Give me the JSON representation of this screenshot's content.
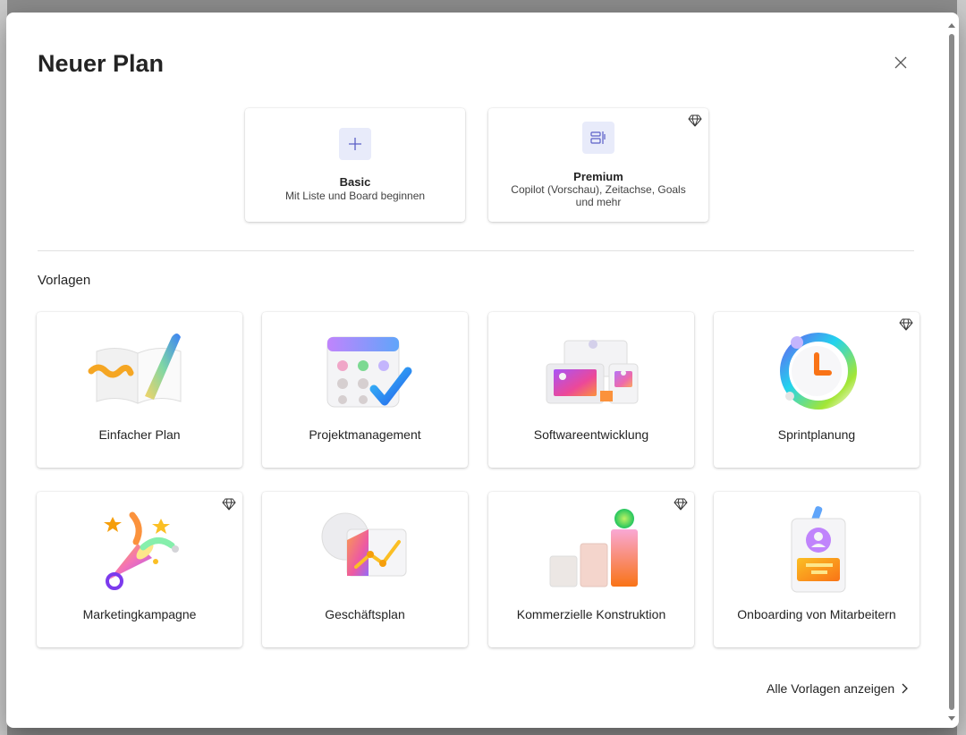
{
  "dialog": {
    "title": "Neuer Plan",
    "close_icon": "close-icon"
  },
  "plans": [
    {
      "name": "Basic",
      "description": "Mit Liste und Board beginnen",
      "icon": "plus-icon",
      "premium": false
    },
    {
      "name": "Premium",
      "description": "Copilot (Vorschau), Zeitachse, Goals und mehr",
      "icon": "timeline-board-icon",
      "premium": true
    }
  ],
  "templates_section": {
    "title": "Vorlagen",
    "items": [
      {
        "label": "Einfacher Plan",
        "icon": "book-pen-illustration",
        "premium": false
      },
      {
        "label": "Projektmanagement",
        "icon": "calendar-check-illustration",
        "premium": false
      },
      {
        "label": "Softwareentwicklung",
        "icon": "devices-illustration",
        "premium": false
      },
      {
        "label": "Sprintplanung",
        "icon": "clock-ring-illustration",
        "premium": true
      },
      {
        "label": "Marketingkampagne",
        "icon": "megaphone-illustration",
        "premium": true
      },
      {
        "label": "Geschäftsplan",
        "icon": "chart-board-illustration",
        "premium": false
      },
      {
        "label": "Kommerzielle Konstruktion",
        "icon": "building-blocks-illustration",
        "premium": true
      },
      {
        "label": "Onboarding von Mitarbeitern",
        "icon": "badge-illustration",
        "premium": false
      }
    ],
    "all_templates_label": "Alle Vorlagen anzeigen"
  },
  "colors": {
    "accent": "#5b5fc7",
    "icon_bg": "#e8ebfa",
    "text": "#242424"
  }
}
